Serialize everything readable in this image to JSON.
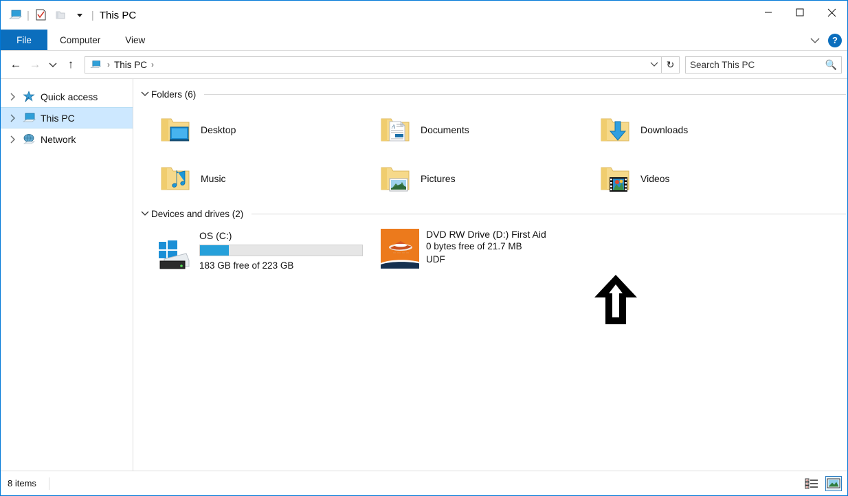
{
  "window": {
    "title": "This PC",
    "quick_access_toolbar": [
      {
        "name": "this-pc-icon",
        "label": "This PC"
      },
      {
        "name": "properties-icon",
        "label": "Properties"
      },
      {
        "name": "new-folder-icon",
        "label": "New folder"
      },
      {
        "name": "customize-dropdown-icon",
        "label": "Customize Quick Access Toolbar"
      }
    ],
    "controls": {
      "minimize": "Minimize",
      "maximize": "Maximize",
      "close": "Close"
    }
  },
  "ribbon": {
    "file_tab": "File",
    "tabs": [
      "Computer",
      "View"
    ],
    "expand_label": "Expand the Ribbon",
    "help_label": "?"
  },
  "navigation": {
    "back": "Back",
    "forward": "Forward",
    "recent_locations": "Recent locations",
    "up": "Up",
    "breadcrumb": {
      "icon": "this-pc-icon",
      "items": [
        "This PC"
      ],
      "separator": "›"
    },
    "refresh": "Refresh",
    "address_dropdown": "Previous locations"
  },
  "search": {
    "placeholder": "Search This PC",
    "icon": "search-icon"
  },
  "sidebar": {
    "items": [
      {
        "label": "Quick access",
        "icon": "star-pin-icon",
        "selected": false,
        "expandable": true
      },
      {
        "label": "This PC",
        "icon": "this-pc-icon",
        "selected": true,
        "expandable": true
      },
      {
        "label": "Network",
        "icon": "network-icon",
        "selected": false,
        "expandable": true
      }
    ]
  },
  "content": {
    "groups": [
      {
        "title": "Folders (6)",
        "expanded": true,
        "items": [
          {
            "label": "Desktop",
            "icon": "folder-desktop-icon"
          },
          {
            "label": "Documents",
            "icon": "folder-documents-icon"
          },
          {
            "label": "Downloads",
            "icon": "folder-downloads-icon"
          },
          {
            "label": "Music",
            "icon": "folder-music-icon"
          },
          {
            "label": "Pictures",
            "icon": "folder-pictures-icon"
          },
          {
            "label": "Videos",
            "icon": "folder-videos-icon"
          }
        ]
      },
      {
        "title": "Devices and drives (2)",
        "expanded": true,
        "drives": [
          {
            "name": "OS (C:)",
            "icon": "hard-drive-windows-icon",
            "capacity_text": "183 GB free of 223 GB",
            "usage_percent": 18,
            "bar_color": "#26a0da",
            "filesystem": ""
          },
          {
            "name": "DVD RW Drive (D:) First Aid",
            "icon": "dvd-drive-media-thumbnail",
            "capacity_text": "0 bytes free of 21.7 MB",
            "filesystem": "UDF",
            "thumb_color": "#ec7a1c"
          }
        ]
      }
    ],
    "annotation": {
      "name": "up-arrow-annotation",
      "direction": "up",
      "color": "#000000"
    }
  },
  "statusbar": {
    "item_count": "8 items",
    "views": [
      {
        "name": "details-view-button",
        "label": "Details view",
        "active": false
      },
      {
        "name": "large-icons-view-button",
        "label": "Large icons view",
        "active": true
      }
    ]
  }
}
